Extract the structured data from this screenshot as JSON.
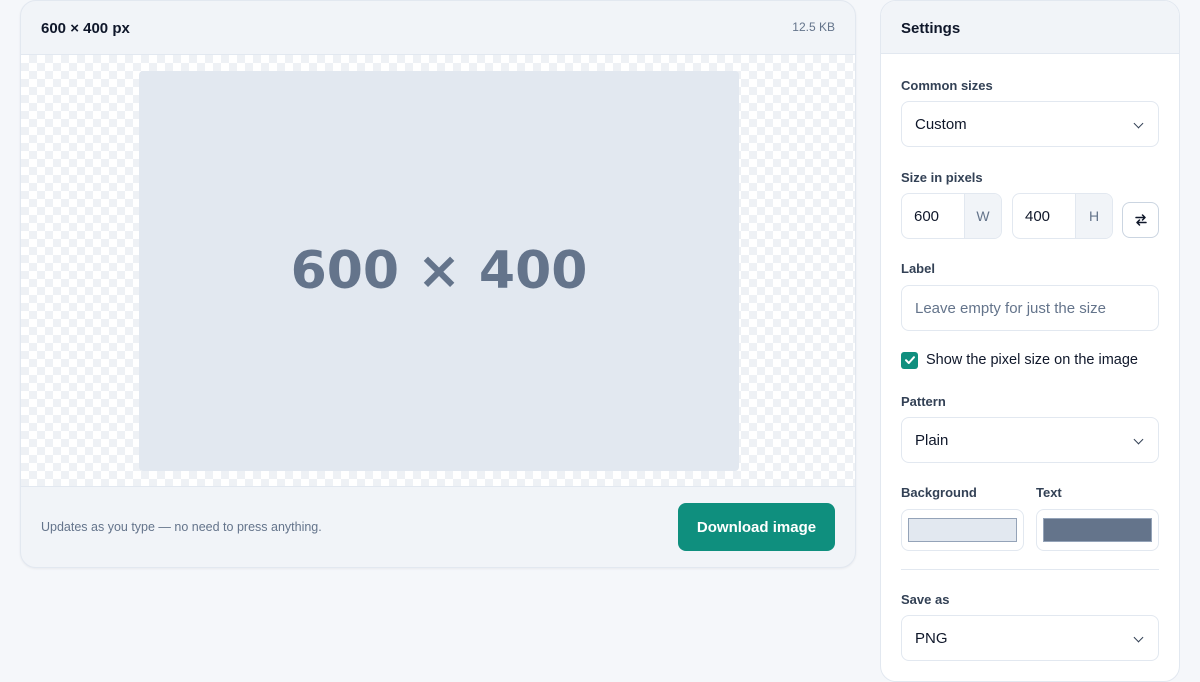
{
  "preview": {
    "title": "600 × 400 px",
    "file_size": "12.5 KB",
    "image_text": "600 × 400",
    "hint": "Updates as you type — no need to press anything.",
    "download_label": "Download image"
  },
  "settings": {
    "title": "Settings",
    "common_sizes": {
      "label": "Common sizes",
      "value": "Custom"
    },
    "size": {
      "label": "Size in pixels",
      "width_value": "600",
      "width_unit": "W",
      "height_value": "400",
      "height_unit": "H"
    },
    "label_field": {
      "label": "Label",
      "placeholder": "Leave empty for just the size",
      "value": ""
    },
    "show_size": {
      "label": "Show the pixel size on the image",
      "checked": true
    },
    "pattern": {
      "label": "Pattern",
      "value": "Plain"
    },
    "background": {
      "label": "Background",
      "color": "#e2e8f0"
    },
    "text": {
      "label": "Text",
      "color": "#64748b"
    },
    "save_as": {
      "label": "Save as",
      "value": "PNG"
    }
  },
  "colors": {
    "accent": "#0f8f7e",
    "image_background": "#e2e8f0",
    "image_text": "#64748b"
  },
  "icons": {
    "swap": "swap-arrows-icon",
    "check": "checkmark-icon",
    "chevron": "chevron-down-icon"
  }
}
